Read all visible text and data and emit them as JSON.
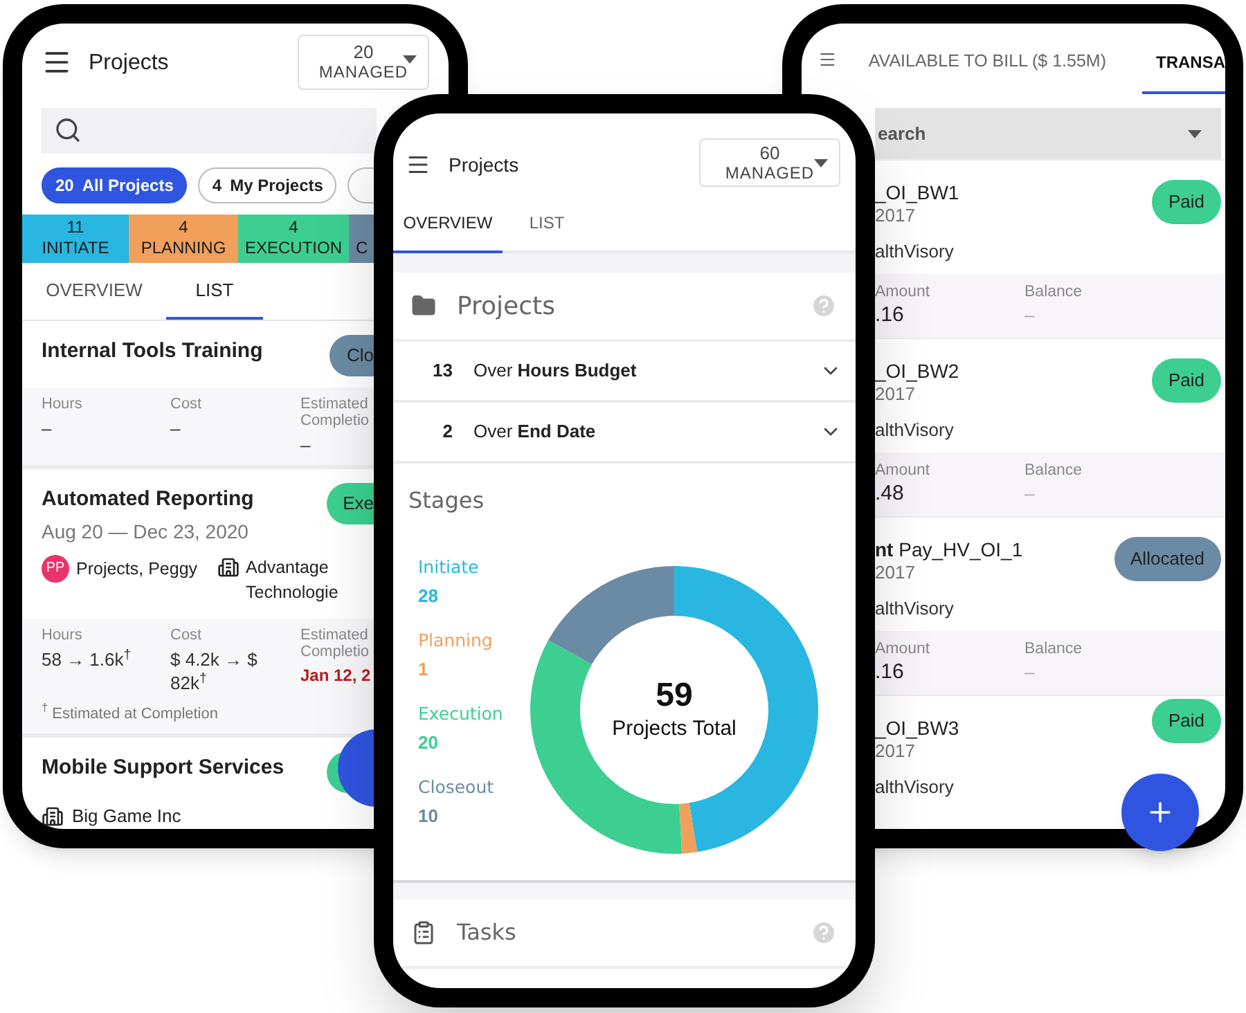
{
  "left_screen": {
    "title": "Projects",
    "managed": {
      "count": "20",
      "label": "MANAGED"
    },
    "filters": [
      {
        "count": "20",
        "label": "All Projects",
        "selected": true
      },
      {
        "count": "4",
        "label": "My Projects",
        "selected": false
      },
      {
        "selected": false
      }
    ],
    "stages": [
      {
        "count": "11",
        "label": "INITIATE",
        "color": "#29b6e0"
      },
      {
        "count": "4",
        "label": "PLANNING",
        "color": "#f0a05a"
      },
      {
        "count": "4",
        "label": "EXECUTION",
        "color": "#3ccf91"
      },
      {
        "label": "C",
        "color": "#6b8ba4"
      }
    ],
    "tabs": [
      {
        "label": "OVERVIEW",
        "selected": false
      },
      {
        "label": "LIST",
        "selected": true
      }
    ],
    "projects": [
      {
        "name": "Internal Tools Training",
        "status": {
          "label": "Clo",
          "color": "#6b8ba4"
        },
        "metrics": [
          {
            "label": "Hours",
            "value": "–",
            "overdue": false
          },
          {
            "label": "Cost",
            "value": "–",
            "overdue": false
          },
          {
            "label": "Estimated Completio",
            "value": "–",
            "overdue": false
          }
        ]
      },
      {
        "name": "Automated Reporting",
        "dates": "Aug 20 — Dec 23, 2020",
        "status": {
          "label": "Exe",
          "color": "#3ccf91"
        },
        "owner": {
          "initials": "PP",
          "name": "Projects, Peggy"
        },
        "client": "Advantage Technologie",
        "metrics": [
          {
            "label": "Hours",
            "value": "58 → 1.6k$^{†}$",
            "overdue": false
          },
          {
            "label": "Cost",
            "value": "$ 4.2k → $ 82k$^{†}$",
            "overdue": false
          },
          {
            "label": "Estimated Completio",
            "value": "Jan 12, 2",
            "overdue": true
          }
        ],
        "footnote": "$^{†}$ Estimated at Completion"
      },
      {
        "name": "Mobile Support Services",
        "status": {
          "color": "#3ccf91"
        },
        "client": "Big Game Inc"
      }
    ]
  },
  "center_screen": {
    "title": "Projects",
    "managed": {
      "count": "60",
      "label": "MANAGED"
    },
    "tabs": [
      {
        "label": "OVERVIEW",
        "selected": true
      },
      {
        "label": "LIST",
        "selected": false
      }
    ],
    "projects_section": {
      "title": "Projects",
      "alerts": [
        {
          "count": "13",
          "text": "Over **Hours Budget**"
        },
        {
          "count": "2",
          "text": "Over **End Date**"
        }
      ]
    },
    "stages": {
      "title": "Stages",
      "total": "59",
      "total_label": "Projects Total",
      "legend": [
        {
          "label": "Initiate",
          "value": "28",
          "color": "#29b6e0"
        },
        {
          "label": "Planning",
          "value": "1",
          "color": "#f0a05a"
        },
        {
          "label": "Execution",
          "value": "20",
          "color": "#3ccf91"
        },
        {
          "label": "Closeout",
          "value": "10",
          "color": "#6b8ba4"
        }
      ],
      "chart_data": {
        "type": "donut",
        "values": [
          47.46,
          1.69,
          33.9,
          16.95
        ],
        "colors": [
          "#29b6e0",
          "#f0a05a",
          "#3ccf91",
          "#6b8ba4"
        ]
      }
    },
    "tasks": {
      "title": "Tasks"
    }
  },
  "right_screen": {
    "tabs": [
      {
        "label": "AVAILABLE TO BILL ($ 1.55M)",
        "selected": false
      },
      {
        "label": "TRANSA",
        "selected": true
      }
    ],
    "search": {
      "placeholder": "earch"
    },
    "transactions": [
      {
        "title": "_OI_BW1",
        "date": "2017",
        "client": "althVisory",
        "status": {
          "label": "Paid",
          "color": "#3ccf91"
        },
        "metrics": [
          {
            "label": "Amount",
            "value": ".16"
          },
          {
            "label": "Balance",
            "value": "–"
          }
        ]
      },
      {
        "title": "_OI_BW2",
        "date": "2017",
        "client": "althVisory",
        "status": {
          "label": "Paid",
          "color": "#3ccf91"
        },
        "metrics": [
          {
            "label": "Amount",
            "value": ".48"
          },
          {
            "label": "Balance",
            "value": "–"
          }
        ]
      },
      {
        "title": "**nt** Pay_HV_OI_1",
        "date": "2017",
        "client": "althVisory",
        "status": {
          "label": "Allocated",
          "color": "#6b8ba4"
        },
        "metrics": [
          {
            "label": "Amount",
            "value": ".16"
          },
          {
            "label": "Balance",
            "value": "–"
          }
        ]
      },
      {
        "title": "_OI_BW3",
        "date": "2017",
        "client": "althVisory",
        "status": {
          "label": "Paid",
          "color": "#3ccf91"
        }
      }
    ]
  }
}
